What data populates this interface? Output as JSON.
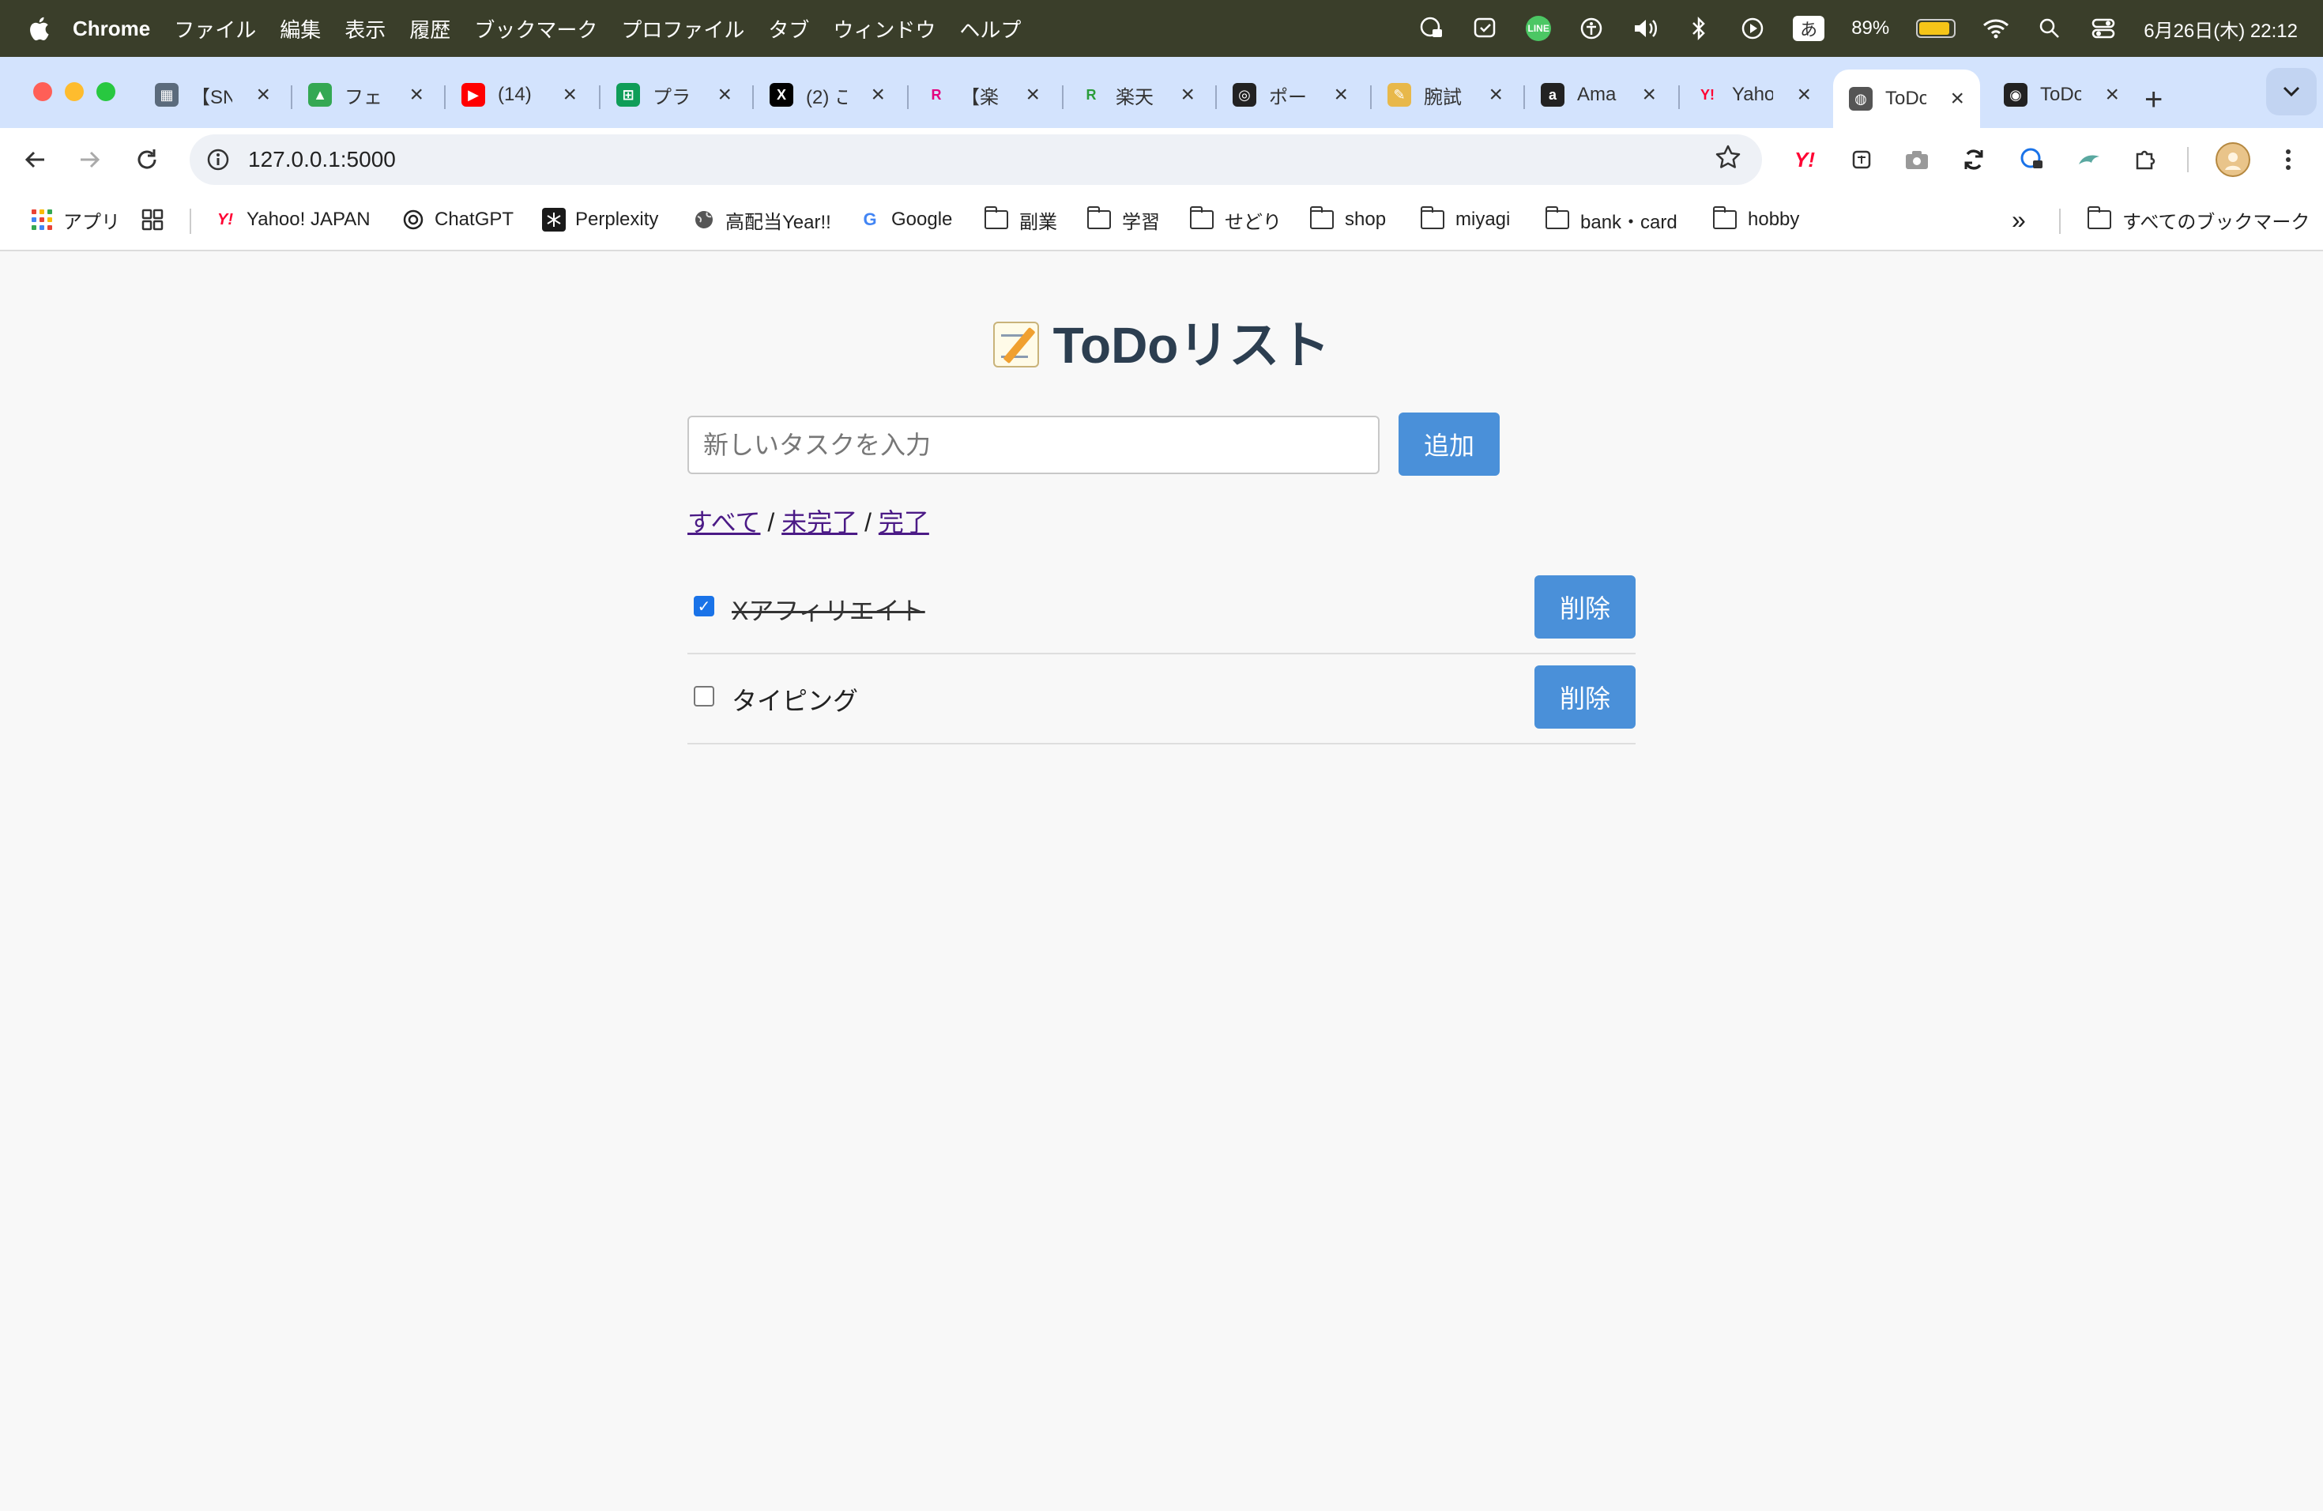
{
  "menubar": {
    "app_name": "Chrome",
    "menus": [
      "ファイル",
      "編集",
      "表示",
      "履歴",
      "ブックマーク",
      "プロファイル",
      "タブ",
      "ウィンドウ",
      "ヘルプ"
    ],
    "ime_label": "あ",
    "battery_percent": "89%",
    "battery_level": 0.89,
    "line_icon_label": "LINE",
    "datetime": "6月26日(木) 22:12"
  },
  "tabs": [
    {
      "title": "【SN",
      "favicon": "grid-icon",
      "color": "#5b6b7c"
    },
    {
      "title": "フェ",
      "favicon": "google-drive-icon",
      "color": "#34a853"
    },
    {
      "title": "(14)",
      "favicon": "youtube-icon",
      "color": "#ff0000"
    },
    {
      "title": "プラ",
      "favicon": "google-sheets-icon",
      "color": "#0f9d58"
    },
    {
      "title": "(2) こ",
      "favicon": "x-icon",
      "color": "#000000"
    },
    {
      "title": "【楽",
      "favicon": "rakuten-r-icon",
      "color": "#e4007f"
    },
    {
      "title": "楽天",
      "favicon": "rakuten-r-green-icon",
      "color": "#2a9d3a"
    },
    {
      "title": "ポー",
      "favicon": "openai-icon",
      "color": "#222222"
    },
    {
      "title": "腕試",
      "favicon": "note-icon",
      "color": "#e8b84a"
    },
    {
      "title": "Ama",
      "favicon": "amazon-icon",
      "color": "#222222"
    },
    {
      "title": "Yaho",
      "favicon": "yahoo-icon",
      "color": "#ff0033"
    },
    {
      "title": "ToDo",
      "favicon": "globe-icon",
      "color": "#555555",
      "active": true
    },
    {
      "title": "ToDo",
      "favicon": "github-icon",
      "color": "#222222"
    }
  ],
  "toolbar": {
    "url": "127.0.0.1:5000"
  },
  "bookmarks": [
    {
      "label": "アプリ",
      "icon": "apps-grid-icon"
    },
    {
      "label": "Yahoo! JAPAN",
      "icon": "yahoo-icon"
    },
    {
      "label": "ChatGPT",
      "icon": "openai-icon"
    },
    {
      "label": "Perplexity",
      "icon": "perplexity-icon"
    },
    {
      "label": "高配当Year!!",
      "icon": "globe-icon"
    },
    {
      "label": "Google",
      "icon": "google-icon"
    },
    {
      "label": "副業",
      "icon": "folder-icon"
    },
    {
      "label": "学習",
      "icon": "folder-icon"
    },
    {
      "label": "せどり",
      "icon": "folder-icon"
    },
    {
      "label": "shop",
      "icon": "folder-icon"
    },
    {
      "label": "miyagi",
      "icon": "folder-icon"
    },
    {
      "label": "bank・card",
      "icon": "folder-icon"
    },
    {
      "label": "hobby",
      "icon": "folder-icon"
    }
  ],
  "bookmarks_overflow": "»",
  "all_bookmarks_label": "すべてのブックマーク",
  "page": {
    "title": "ToDoリスト",
    "input_placeholder": "新しいタスクを入力",
    "add_button": "追加",
    "filters": {
      "all": "すべて",
      "incomplete": "未完了",
      "complete": "完了",
      "separator": "/"
    },
    "todos": [
      {
        "text": "Xアフィリエイト",
        "done": true,
        "delete_label": "削除"
      },
      {
        "text": "タイピング",
        "done": false,
        "delete_label": "削除"
      }
    ]
  },
  "colors": {
    "primary_button": "#4a90d9",
    "heading": "#2c3e50",
    "link_visited": "#4b1a86",
    "tabstrip_bg": "#d3e3fd"
  }
}
